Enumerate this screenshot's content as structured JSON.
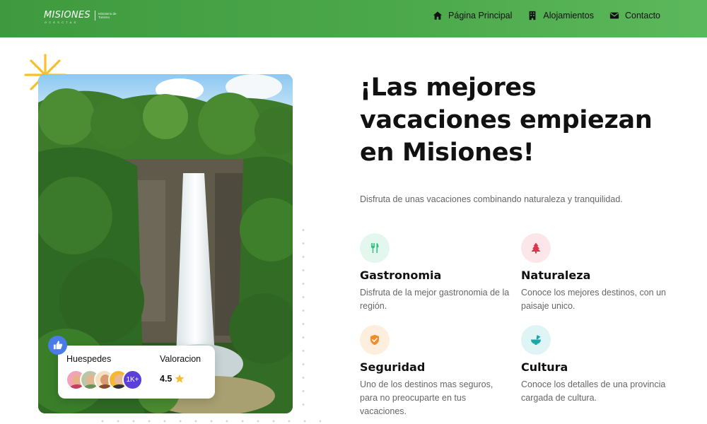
{
  "header": {
    "logo": {
      "name": "MISIONES",
      "subtext": "OCESCTAS",
      "tagline": "Ministerio de Turismo"
    },
    "nav": [
      {
        "label": "Página Principal",
        "icon": "home-icon"
      },
      {
        "label": "Alojamientos",
        "icon": "building-icon"
      },
      {
        "label": "Contacto",
        "icon": "envelope-icon"
      }
    ]
  },
  "hero": {
    "title": "¡Las mejores vacaciones empiezan en Misiones!",
    "subtitle": "Disfruta de unas vacaciones combinando naturaleza y tranquilidad."
  },
  "stats": {
    "guests_label": "Huespedes",
    "guests_count": "1K+",
    "rating_label": "Valoracion",
    "rating_value": "4.5"
  },
  "features": [
    {
      "title": "Gastronomia",
      "desc": "Disfruta de la mejor gastronomia de la región.",
      "icon": "utensils-icon",
      "color": "#2ec27e"
    },
    {
      "title": "Naturaleza",
      "desc": "Conoce los mejores destinos, con un paisaje unico.",
      "icon": "tree-icon",
      "color": "#e0344a"
    },
    {
      "title": "Seguridad",
      "desc": "Uno de los destinos mas seguros, para no preocuparte en tus vacaciones.",
      "icon": "shield-icon",
      "color": "#f28c28"
    },
    {
      "title": "Cultura",
      "desc": "Conoce los detalles de una provincia cargada de cultura.",
      "icon": "mortar-icon",
      "color": "#1aa7a7"
    }
  ],
  "colors": {
    "header_green": "#4ba84a",
    "accent_yellow": "#f6c02c",
    "like_blue": "#4a7be8",
    "count_purple": "#5a3fd9"
  }
}
